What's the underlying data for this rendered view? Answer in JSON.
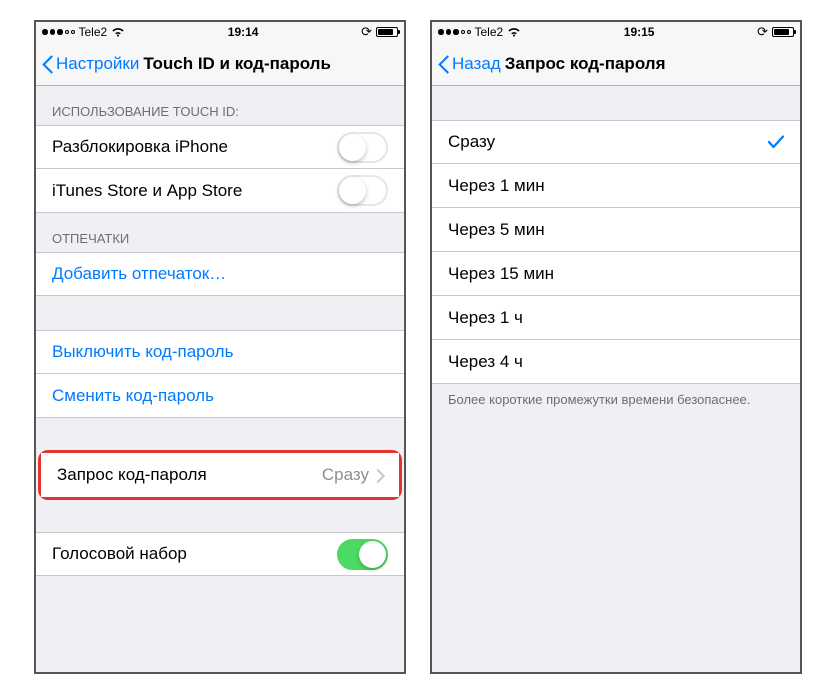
{
  "left": {
    "status": {
      "carrier": "Tele2",
      "time": "19:14"
    },
    "nav": {
      "back": "Настройки",
      "title": "Touch ID и код-пароль"
    },
    "section_touchid_header": "ИСПОЛЬЗОВАНИЕ TOUCH ID:",
    "unlock_iphone": "Разблокировка iPhone",
    "itunes_appstore": "iTunes Store и App Store",
    "section_fingerprints_header": "ОТПЕЧАТКИ",
    "add_fingerprint": "Добавить отпечаток…",
    "turn_off_passcode": "Выключить код-пароль",
    "change_passcode": "Сменить код-пароль",
    "require_passcode_label": "Запрос код-пароля",
    "require_passcode_value": "Сразу",
    "voice_dial": "Голосовой набор"
  },
  "right": {
    "status": {
      "carrier": "Tele2",
      "time": "19:15"
    },
    "nav": {
      "back": "Назад",
      "title": "Запрос код-пароля"
    },
    "options": [
      {
        "label": "Сразу",
        "selected": true
      },
      {
        "label": "Через 1 мин",
        "selected": false
      },
      {
        "label": "Через 5 мин",
        "selected": false
      },
      {
        "label": "Через 15 мин",
        "selected": false
      },
      {
        "label": "Через 1 ч",
        "selected": false
      },
      {
        "label": "Через 4 ч",
        "selected": false
      }
    ],
    "footer": "Более короткие промежутки времени безопаснее."
  }
}
